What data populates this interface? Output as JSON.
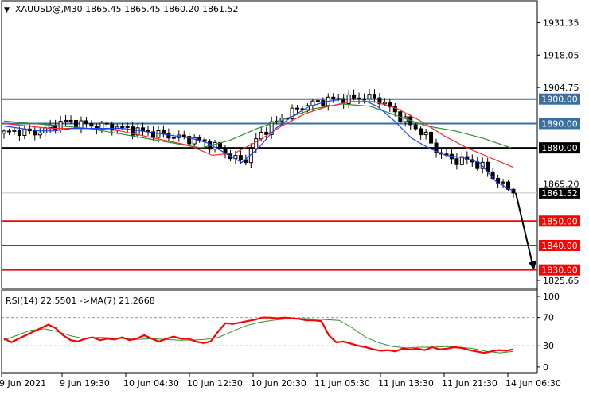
{
  "header": {
    "symbol_text": "XAUUSD@,M30  1865.45 1865.45 1860.20 1861.52",
    "dropdown_glyph": "▼"
  },
  "colors": {
    "bg": "#ffffff",
    "candle": "#000000",
    "ma_blue": "#1f3fff",
    "ma_red": "#ff2a2a",
    "ma_green": "#2f8f2f",
    "rsi_line": "#ff0000",
    "rsi_ma": "#2f8f2f",
    "resistance": "#3a6fa0",
    "pivot": "#000000",
    "support": "#ff0000",
    "arrow": "#000000"
  },
  "chart_data": [
    {
      "type": "candlestick",
      "y_ticks": [
        1931.35,
        1918.05,
        1904.75,
        1865.2,
        1825.65
      ],
      "ylim": [
        1822.4,
        1940.3
      ],
      "x_tick_labels": [
        "9 Jun 2021",
        "9 Jun 19:30",
        "10 Jun 04:30",
        "10 Jun 12:30",
        "10 Jun 20:30",
        "11 Jun 05:30",
        "11 Jun 13:30",
        "11 Jun 21:30",
        "14 Jun 06:30"
      ],
      "current_price": 1861.52,
      "current_price_label": "1861.52",
      "levels": [
        {
          "value": 1900.0,
          "label": "1900.00",
          "kind": "resistance"
        },
        {
          "value": 1890.0,
          "label": "1890.00",
          "kind": "resistance"
        },
        {
          "value": 1880.0,
          "label": "1880.00",
          "kind": "pivot"
        },
        {
          "value": 1850.0,
          "label": "1850.00",
          "kind": "support"
        },
        {
          "value": 1840.0,
          "label": "1840.00",
          "kind": "support"
        },
        {
          "value": 1830.0,
          "label": "1830.00",
          "kind": "support"
        }
      ],
      "close_path": [
        1886,
        1887,
        1886,
        1888,
        1891,
        1890,
        1889,
        1889,
        1888,
        1887,
        1886,
        1885,
        1884,
        1883,
        1881,
        1877,
        1874,
        1885,
        1890,
        1894,
        1897,
        1899,
        1900,
        1900,
        1901,
        1900,
        1895,
        1890,
        1886,
        1878,
        1875,
        1875,
        1872,
        1866,
        1861.5
      ],
      "ma_blue": [
        1889,
        1888,
        1887,
        1887,
        1888,
        1888,
        1888,
        1888,
        1887,
        1886,
        1885,
        1884,
        1882,
        1878,
        1874,
        1880,
        1888,
        1893,
        1897,
        1899,
        1900,
        1900,
        1897,
        1891,
        1884,
        1880,
        1877,
        1876,
        1874,
        1866,
        1862.3
      ],
      "ma_red": [
        1890,
        1889,
        1888,
        1888,
        1888,
        1887,
        1885,
        1883,
        1881,
        1877,
        1878,
        1883,
        1889,
        1894,
        1897,
        1899,
        1899,
        1896,
        1891,
        1885,
        1880,
        1876,
        1872
      ],
      "ma_green": [
        1891,
        1890,
        1889,
        1888,
        1886,
        1884,
        1882,
        1880,
        1883,
        1888,
        1892,
        1896,
        1898,
        1897,
        1893,
        1889,
        1887,
        1884,
        1880
      ]
    },
    {
      "type": "line",
      "title": "RSI(14) 22.5501  ->MA(7) 21.2668",
      "y_ticks": [
        100,
        70,
        30,
        0
      ],
      "ylim": [
        -8,
        109
      ],
      "series": [
        {
          "role": "rsi",
          "values": [
            40,
            35,
            40,
            45,
            50,
            55,
            60,
            55,
            45,
            38,
            36,
            40,
            42,
            38,
            40,
            39,
            42,
            38,
            40,
            45,
            40,
            36,
            40,
            43,
            40,
            40,
            36,
            34,
            36,
            50,
            62,
            61,
            63,
            65,
            67,
            70,
            70,
            69,
            70,
            69,
            68,
            66,
            66,
            65,
            45,
            35,
            36,
            33,
            30,
            28,
            25,
            23,
            24,
            22,
            26,
            25,
            26,
            24,
            28,
            25,
            26,
            28,
            27,
            24,
            22,
            20,
            22,
            24,
            23,
            25
          ]
        },
        {
          "role": "rsi_ma",
          "values": [
            38,
            45,
            52,
            54,
            50,
            44,
            40,
            42,
            41,
            40,
            39,
            40,
            39,
            38,
            38,
            39,
            42,
            50,
            58,
            63,
            66,
            68,
            69,
            68,
            67,
            66,
            55,
            42,
            34,
            29,
            27,
            28,
            28,
            29,
            28,
            26,
            22,
            20,
            22
          ]
        }
      ]
    }
  ]
}
